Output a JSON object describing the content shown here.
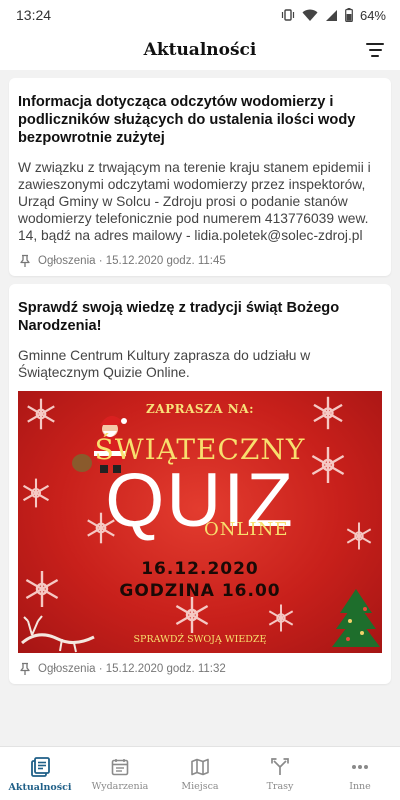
{
  "status_bar": {
    "time": "13:24",
    "battery": "64%",
    "icons": [
      "vibrate-icon",
      "wifi-icon",
      "signal-icon",
      "battery-icon"
    ]
  },
  "header": {
    "title": "Aktualności",
    "filter_icon": "filter-icon"
  },
  "posts": [
    {
      "title": "Informacja dotycząca odczytów wodomierzy i podliczników służących do ustalenia ilości wody bezpowrotnie zużytej",
      "body": "W związku z trwającym na terenie kraju stanem epidemii i zawieszonymi odczytami wodomierzy przez inspektorów, Urząd Gminy w Solcu - Zdroju prosi o podanie stanów wodomierzy telefonicznie pod numerem 413776039 wew. 14, bądź na adres mailowy - lidia.poletek@solec-zdroj.pl",
      "meta": "Ogłoszenia · 15.12.2020 godz. 11:45"
    },
    {
      "title": "Sprawdź swoją wiedzę z tradycji świąt Bożego Narodzenia!",
      "body": "Gminne Centrum Kultury zaprasza do udziału w Świątecznym Quizie Online.",
      "image": {
        "line1": "ZAPRASZA NA:",
        "line2": "ŚWIĄTECZNY",
        "line3": "QUIZ",
        "line4": "ONLINE",
        "line5": "16.12.2020",
        "line6": "GODZINA 16.00",
        "line7": "SPRAWDŹ SWOJĄ WIEDZĘ"
      },
      "meta": "Ogłoszenia · 15.12.2020 godz. 11:32"
    }
  ],
  "bottom_nav": [
    {
      "label": "Aktualności",
      "icon": "news-icon",
      "active": true
    },
    {
      "label": "Wydarzenia",
      "icon": "calendar-icon",
      "active": false
    },
    {
      "label": "Miejsca",
      "icon": "map-icon",
      "active": false
    },
    {
      "label": "Trasy",
      "icon": "route-icon",
      "active": false
    },
    {
      "label": "Inne",
      "icon": "more-icon",
      "active": false
    }
  ],
  "colors": {
    "accent": "#1f5f87",
    "promo_background": "#c8201b",
    "promo_gold": "#f8df6e"
  }
}
